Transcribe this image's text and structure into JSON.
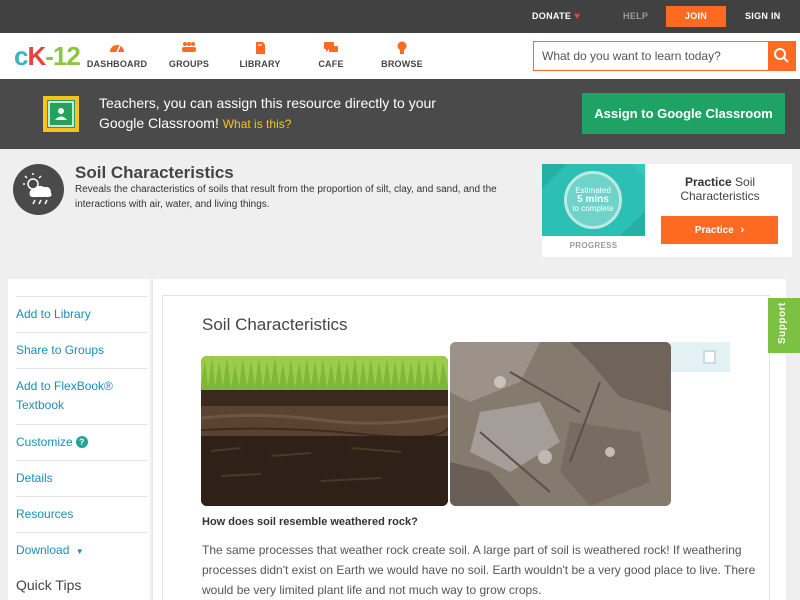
{
  "topbar": {
    "donate": "DONATE",
    "help": "HELP",
    "join": "JOIN",
    "signin": "SIGN IN"
  },
  "nav": {
    "logo": {
      "c": "c",
      "k": "K",
      "n": "-12"
    },
    "items": [
      {
        "label": "DASHBOARD",
        "icon": "dashboard-gauge-icon"
      },
      {
        "label": "GROUPS",
        "icon": "groups-people-icon"
      },
      {
        "label": "LIBRARY",
        "icon": "library-book-icon"
      },
      {
        "label": "CAFE",
        "icon": "cafe-chat-icon"
      },
      {
        "label": "BROWSE",
        "icon": "browse-lightbulb-icon"
      }
    ],
    "search_placeholder": "What do you want to learn today?"
  },
  "banner": {
    "text": "Teachers, you can assign this resource directly to your Google Classroom!",
    "what_link": "What is this?",
    "assign_button": "Assign to Google Classroom"
  },
  "concept": {
    "title": "Soil Characteristics",
    "description": "Reveals the characteristics of soils that result from the proportion of silt, clay, and sand, and the interactions with air, water, and living things."
  },
  "practice_card": {
    "estimated": "Estimated",
    "mins": "5 mins",
    "complete": "to complete",
    "progress_label": "PROGRESS",
    "title_bold": "Practice",
    "title_rest": "Soil Characteristics",
    "button": "Practice"
  },
  "sidebar": {
    "items": [
      {
        "label": "Add to Library"
      },
      {
        "label": "Share to Groups"
      },
      {
        "label": "Add to FlexBook® Textbook"
      },
      {
        "label": "Customize"
      },
      {
        "label": "Details"
      },
      {
        "label": "Resources"
      },
      {
        "label": "Download"
      }
    ],
    "quick_tips": "Quick Tips"
  },
  "article": {
    "title": "Soil Characteristics",
    "question": "How does soil resemble weathered rock?",
    "paragraph": "The same processes that weather rock create soil. A large part of soil is weathered rock! If weathering processes didn't exist on Earth we would have no soil. Earth wouldn't be a very good place to live. There would be very limited plant life and not much way to grow crops."
  },
  "support_tab": "Support",
  "colors": {
    "accent": "#ff6a22",
    "link": "#1a8fb4",
    "green_button": "#1ea364",
    "banner_bg": "#4a4a4a"
  }
}
